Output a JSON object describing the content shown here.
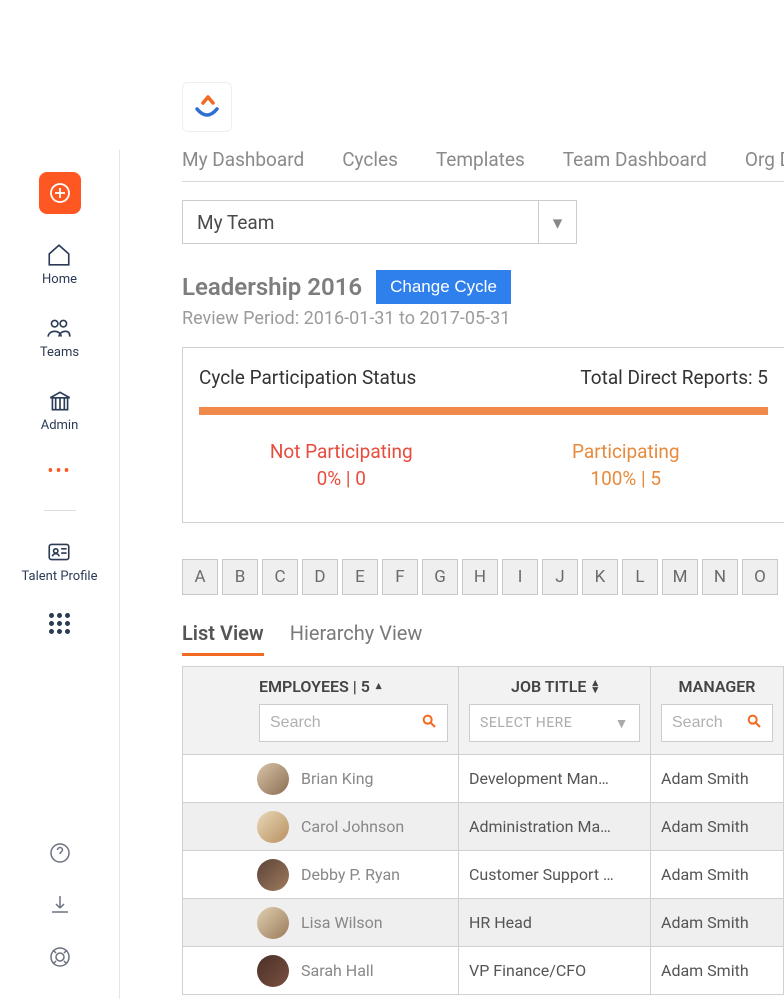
{
  "sidebar": {
    "items": [
      {
        "label": "Home"
      },
      {
        "label": "Teams"
      },
      {
        "label": "Admin"
      },
      {
        "label": "Talent Profile"
      }
    ]
  },
  "top_tabs": [
    "My Dashboard",
    "Cycles",
    "Templates",
    "Team Dashboard",
    "Org Dash"
  ],
  "team_select": {
    "value": "My Team"
  },
  "cycle": {
    "title": "Leadership 2016",
    "change_label": "Change Cycle",
    "review_period": "Review Period: 2016-01-31 to 2017-05-31"
  },
  "status": {
    "heading": "Cycle Participation Status",
    "total_label": "Total Direct Reports: 5",
    "not_participating": {
      "label": "Not Participating",
      "value": "0% | 0"
    },
    "participating": {
      "label": "Participating",
      "value": "100% | 5"
    }
  },
  "alphabet": [
    "A",
    "B",
    "C",
    "D",
    "E",
    "F",
    "G",
    "H",
    "I",
    "J",
    "K",
    "L",
    "M",
    "N",
    "O"
  ],
  "view_tabs": {
    "list": "List View",
    "hierarchy": "Hierarchy View"
  },
  "table": {
    "headers": {
      "employees": "EMPLOYEES | 5",
      "job_title": "JOB TITLE",
      "manager": "MANAGER"
    },
    "search_placeholder": "Search",
    "select_placeholder": "SELECT HERE",
    "rows": [
      {
        "name": "Brian King",
        "job": "Development Man…",
        "manager": "Adam Smith"
      },
      {
        "name": "Carol Johnson",
        "job": "Administration Ma…",
        "manager": "Adam Smith"
      },
      {
        "name": "Debby P. Ryan",
        "job": "Customer Support …",
        "manager": "Adam Smith"
      },
      {
        "name": "Lisa Wilson",
        "job": "HR Head",
        "manager": "Adam Smith"
      },
      {
        "name": "Sarah Hall",
        "job": "VP Finance/CFO",
        "manager": "Adam Smith"
      }
    ]
  }
}
